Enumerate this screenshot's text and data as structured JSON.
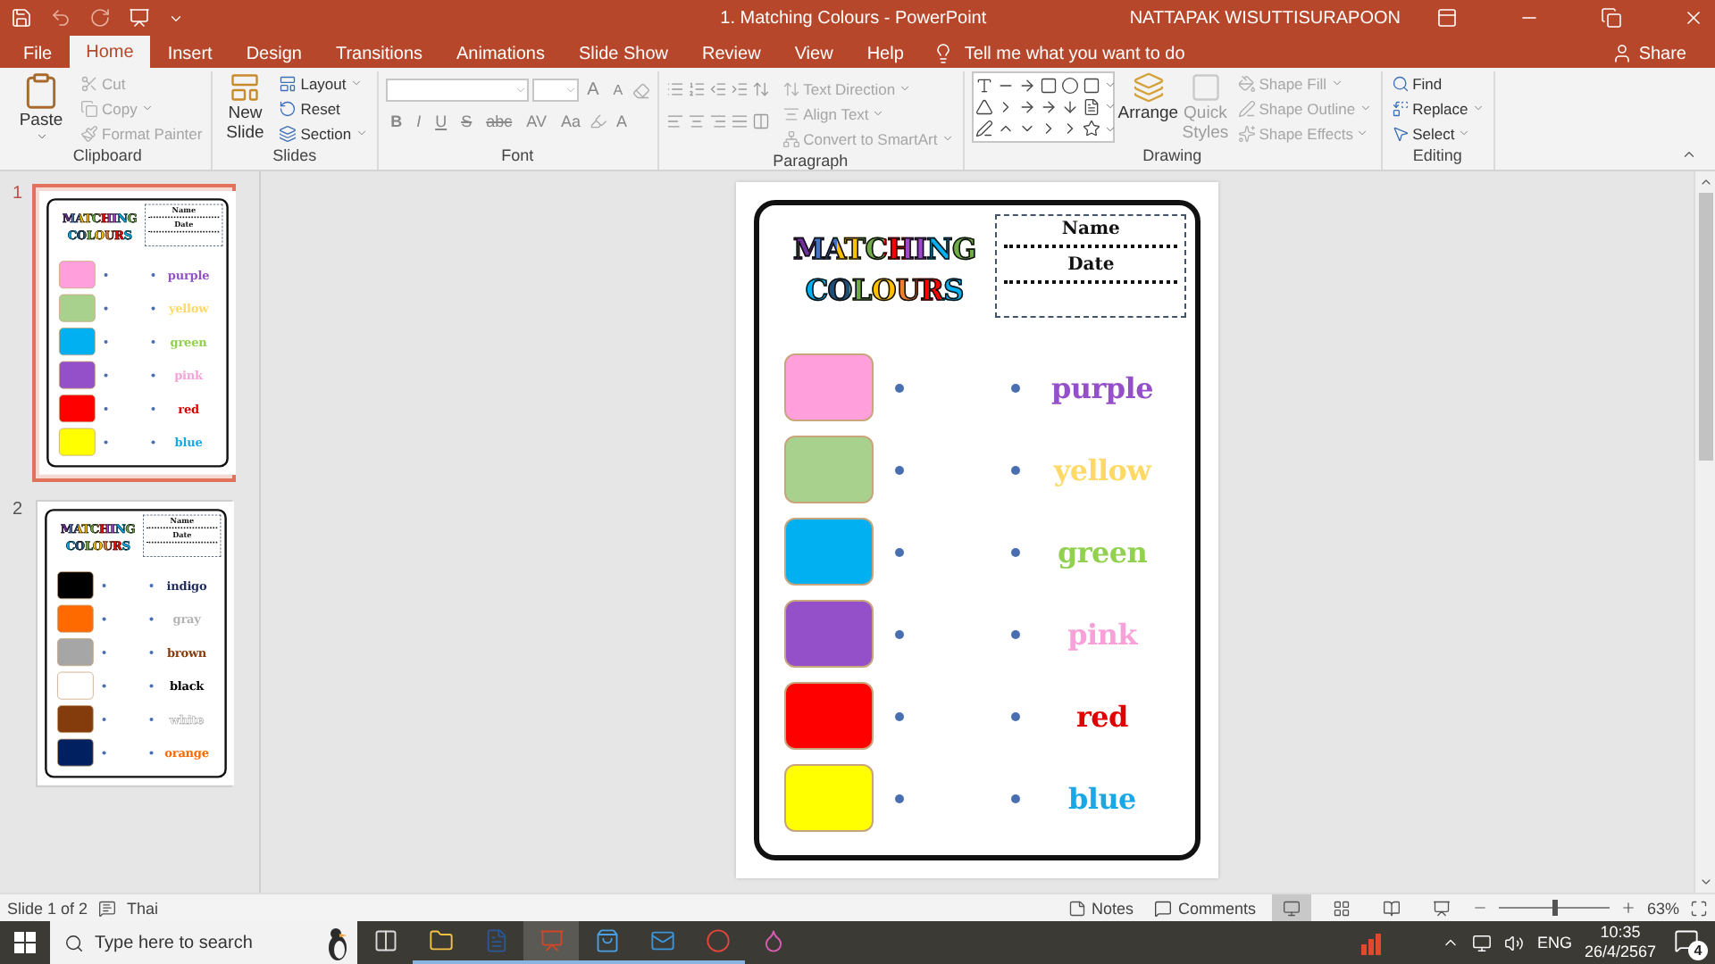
{
  "window": {
    "title": "1. Matching Colours  -  PowerPoint",
    "user": "NATTAPAK WISUTTISURAPOON"
  },
  "tabs": [
    {
      "label": "File",
      "selected": false
    },
    {
      "label": "Home",
      "selected": true
    },
    {
      "label": "Insert",
      "selected": false
    },
    {
      "label": "Design",
      "selected": false
    },
    {
      "label": "Transitions",
      "selected": false
    },
    {
      "label": "Animations",
      "selected": false
    },
    {
      "label": "Slide Show",
      "selected": false
    },
    {
      "label": "Review",
      "selected": false
    },
    {
      "label": "View",
      "selected": false
    },
    {
      "label": "Help",
      "selected": false
    }
  ],
  "tell_me": {
    "placeholder": "Tell me what you want to do"
  },
  "share": "Share",
  "ribbon": {
    "clipboard": {
      "label": "Clipboard",
      "paste": "Paste",
      "items": [
        {
          "label": "Cut",
          "disabled": true
        },
        {
          "label": "Copy",
          "disabled": true
        },
        {
          "label": "Format Painter",
          "disabled": true
        }
      ]
    },
    "slides": {
      "label": "Slides",
      "new_slide": "New Slide",
      "items": [
        {
          "label": "Layout",
          "disabled": false
        },
        {
          "label": "Reset",
          "disabled": false
        },
        {
          "label": "Section",
          "disabled": false
        }
      ]
    },
    "font": {
      "label": "Font",
      "size_buttons": [
        "A",
        "A"
      ],
      "format_buttons": [
        "B",
        "I",
        "U",
        "S",
        "abc",
        "AV",
        "Aa"
      ],
      "color_button": "A"
    },
    "paragraph": {
      "label": "Paragraph",
      "items": [
        {
          "label": "Text Direction",
          "disabled": true
        },
        {
          "label": "Align Text",
          "disabled": true
        },
        {
          "label": "Convert to SmartArt",
          "disabled": true
        }
      ]
    },
    "drawing": {
      "label": "Drawing",
      "arrange": "Arrange",
      "quick_styles": {
        "label": "Quick Styles",
        "disabled": true
      },
      "items": [
        {
          "label": "Shape Fill",
          "disabled": true
        },
        {
          "label": "Shape Outline",
          "disabled": true
        },
        {
          "label": "Shape Effects",
          "disabled": true
        }
      ]
    },
    "editing": {
      "label": "Editing",
      "items": [
        {
          "label": "Find",
          "disabled": false
        },
        {
          "label": "Replace",
          "disabled": false
        },
        {
          "label": "Select",
          "disabled": false
        }
      ]
    }
  },
  "slides": [
    {
      "number": "1",
      "selected": true,
      "content": {
        "title_lines": [
          "MATCHING",
          "COLOURS"
        ],
        "name_label": "Name",
        "date_label": "Date",
        "rows": [
          {
            "swatch": {
              "color": "#ff9fdc"
            },
            "word": {
              "label": "purple",
              "color": "#9450c8"
            }
          },
          {
            "swatch": {
              "color": "#a9d18e"
            },
            "word": {
              "label": "yellow",
              "color": "#ffd966"
            }
          },
          {
            "swatch": {
              "color": "#00b0f0"
            },
            "word": {
              "label": "green",
              "color": "#92d050"
            }
          },
          {
            "swatch": {
              "color": "#9450c8"
            },
            "word": {
              "label": "pink",
              "color": "#f7a1d8"
            }
          },
          {
            "swatch": {
              "color": "#ff0000"
            },
            "word": {
              "label": "red",
              "color": "#e00000"
            }
          },
          {
            "swatch": {
              "color": "#ffff00"
            },
            "word": {
              "label": "blue",
              "color": "#1aa7e6"
            }
          }
        ]
      }
    },
    {
      "number": "2",
      "selected": false,
      "content": {
        "title_lines": [
          "MATCHING",
          "COLOURS"
        ],
        "name_label": "Name",
        "date_label": "Date",
        "rows": [
          {
            "swatch": {
              "color": "#000000"
            },
            "word": {
              "label": "indigo",
              "color": "#1f2a5c"
            }
          },
          {
            "swatch": {
              "color": "#ff6a00"
            },
            "word": {
              "label": "gray",
              "color": "#b4b4b4"
            }
          },
          {
            "swatch": {
              "color": "#a6a6a6"
            },
            "word": {
              "label": "brown",
              "color": "#843c0c"
            }
          },
          {
            "swatch": {
              "color": "#ffffff"
            },
            "word": {
              "label": "black",
              "color": "#000000"
            }
          },
          {
            "swatch": {
              "color": "#843c0c"
            },
            "word": {
              "label": "white",
              "color": "#ffffff"
            }
          },
          {
            "swatch": {
              "color": "#002060"
            },
            "word": {
              "label": "orange",
              "color": "#ff6a00"
            }
          }
        ]
      }
    }
  ],
  "editor": {
    "content": {
      "title_lines": [
        "MATCHING",
        "COLOURS"
      ],
      "name_label": "Name",
      "date_label": "Date",
      "rows": [
        {
          "swatch": {
            "color": "#ff9fdc"
          },
          "word": {
            "label": "purple",
            "color": "#9450c8"
          }
        },
        {
          "swatch": {
            "color": "#a9d18e"
          },
          "word": {
            "label": "yellow",
            "color": "#ffd966"
          }
        },
        {
          "swatch": {
            "color": "#00b0f0"
          },
          "word": {
            "label": "green",
            "color": "#92d050"
          }
        },
        {
          "swatch": {
            "color": "#9450c8"
          },
          "word": {
            "label": "pink",
            "color": "#f7a1d8"
          }
        },
        {
          "swatch": {
            "color": "#ff0000"
          },
          "word": {
            "label": "red",
            "color": "#e00000"
          }
        },
        {
          "swatch": {
            "color": "#ffff00"
          },
          "word": {
            "label": "blue",
            "color": "#1aa7e6"
          }
        }
      ]
    }
  },
  "status_bar": {
    "slide_info": "Slide 1 of 2",
    "language": "Thai",
    "notes": "Notes",
    "comments": "Comments",
    "views": [
      {
        "selected": true
      },
      {
        "selected": false
      },
      {
        "selected": false
      },
      {
        "selected": false
      }
    ],
    "zoom": {
      "level": 0.5,
      "reading": "63%"
    }
  },
  "taskbar": {
    "search_placeholder": "Type here to search",
    "apps": [
      {
        "active": false
      },
      {
        "active": false
      },
      {
        "active": false
      },
      {
        "active": true
      },
      {
        "active": false
      },
      {
        "active": false
      },
      {
        "active": false
      },
      {
        "active": false
      }
    ],
    "tray": {
      "language": "ENG",
      "time": "10:35",
      "date": "26/4/2567",
      "notifications": "4"
    }
  }
}
